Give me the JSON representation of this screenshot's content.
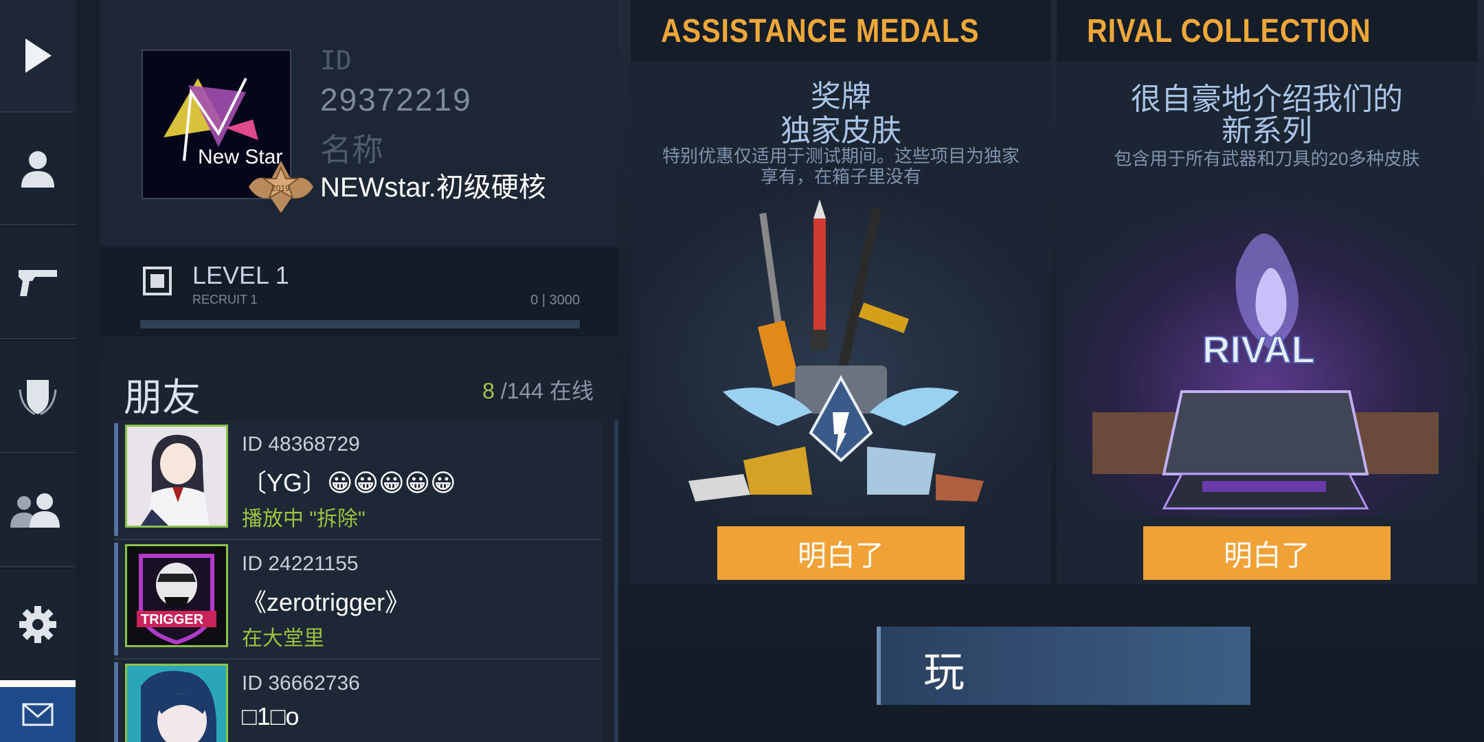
{
  "nav": {
    "items": [
      {
        "name": "play-nav",
        "icon": "play-icon"
      },
      {
        "name": "profile-nav",
        "icon": "user-icon"
      },
      {
        "name": "weapons-nav",
        "icon": "pistol-icon"
      },
      {
        "name": "clan-nav",
        "icon": "shield-icon"
      },
      {
        "name": "friends-nav",
        "icon": "group-icon"
      },
      {
        "name": "settings-nav",
        "icon": "gear-icon"
      }
    ],
    "mail_icon": "mail-icon"
  },
  "profile": {
    "avatar_text": "New Star",
    "badge_year": "2019",
    "id_label": "ID",
    "id_value": "29372219",
    "name_label": "名称",
    "name_value": "NEWstar.初级硬核"
  },
  "level": {
    "title": "LEVEL 1",
    "subtitle": "RECRUIT 1",
    "xp": "0 | 3000",
    "progress": 0
  },
  "friends": {
    "title": "朋友",
    "online": "8",
    "total": "/144 在线",
    "list": [
      {
        "id": "ID 48368729",
        "name": "〔YG〕😀😀😀😀😀",
        "status": "播放中 \"拆除\""
      },
      {
        "id": "ID 24221155",
        "name": "《zerotrigger》",
        "status": "在大堂里",
        "avatar_text": "TRIGGER"
      },
      {
        "id": "ID 36662736",
        "name": "□1□o",
        "status": ""
      }
    ]
  },
  "panels": [
    {
      "title": "ASSISTANCE MEDALS",
      "sub1": "奖牌",
      "sub2": "独家皮肤",
      "desc": "特别优惠仅适用于测试期间。这些项目为独家享有，在箱子里没有",
      "button": "明白了"
    },
    {
      "title": "RIVAL COLLECTION",
      "sub1": "很自豪地介绍我们的",
      "sub2": "新系列",
      "desc": "包含用于所有武器和刀具的20多种皮肤",
      "button": "明白了",
      "art_text": "RIVAL"
    }
  ],
  "play_button": "玩",
  "colors": {
    "accent": "#eea83a",
    "online": "#a6c24a",
    "button": "#f0a236"
  }
}
